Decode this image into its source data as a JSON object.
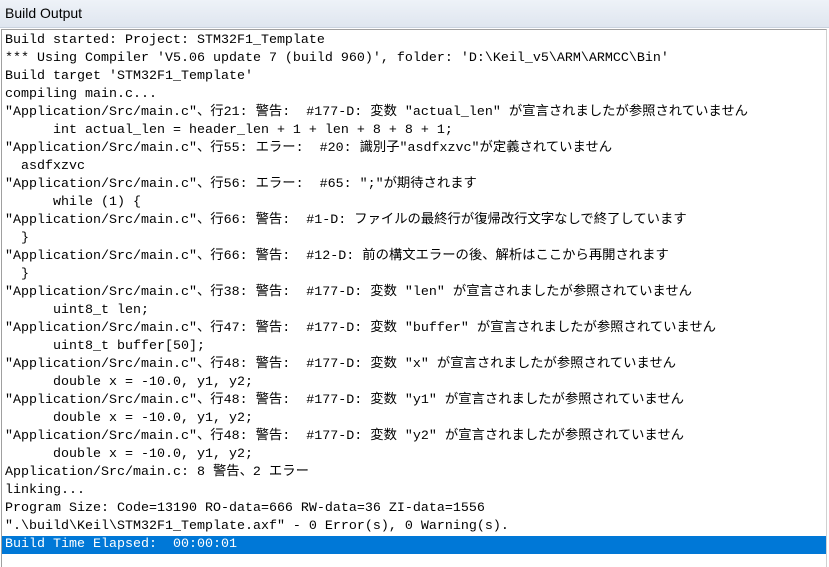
{
  "window": {
    "title": "Build Output"
  },
  "selected_line_index": 28,
  "colors": {
    "selection": "#0078d7"
  },
  "lines": [
    "Build started: Project: STM32F1_Template",
    "*** Using Compiler 'V5.06 update 7 (build 960)', folder: 'D:\\Keil_v5\\ARM\\ARMCC\\Bin'",
    "Build target 'STM32F1_Template'",
    "compiling main.c...",
    "\"Application/Src/main.c\"、行21: 警告:  #177-D: 変数 \"actual_len\" が宣言されましたが参照されていません",
    "      int actual_len = header_len + 1 + len + 8 + 8 + 1;",
    "\"Application/Src/main.c\"、行55: エラー:  #20: 識別子\"asdfxzvc\"が定義されていません",
    "  asdfxzvc",
    "\"Application/Src/main.c\"、行56: エラー:  #65: \";\"が期待されます",
    "      while (1) {",
    "\"Application/Src/main.c\"、行66: 警告:  #1-D: ファイルの最終行が復帰改行文字なしで終了しています",
    "  }",
    "\"Application/Src/main.c\"、行66: 警告:  #12-D: 前の構文エラーの後、解析はここから再開されます",
    "  }",
    "\"Application/Src/main.c\"、行38: 警告:  #177-D: 変数 \"len\" が宣言されましたが参照されていません",
    "      uint8_t len;",
    "\"Application/Src/main.c\"、行47: 警告:  #177-D: 変数 \"buffer\" が宣言されましたが参照されていません",
    "      uint8_t buffer[50];",
    "\"Application/Src/main.c\"、行48: 警告:  #177-D: 変数 \"x\" が宣言されましたが参照されていません",
    "      double x = -10.0, y1, y2;",
    "\"Application/Src/main.c\"、行48: 警告:  #177-D: 変数 \"y1\" が宣言されましたが参照されていません",
    "      double x = -10.0, y1, y2;",
    "\"Application/Src/main.c\"、行48: 警告:  #177-D: 変数 \"y2\" が宣言されましたが参照されていません",
    "      double x = -10.0, y1, y2;",
    "Application/Src/main.c: 8 警告、2 エラー",
    "linking...",
    "Program Size: Code=13190 RO-data=666 RW-data=36 ZI-data=1556",
    "\".\\build\\Keil\\STM32F1_Template.axf\" - 0 Error(s), 0 Warning(s).",
    "Build Time Elapsed:  00:00:01"
  ]
}
